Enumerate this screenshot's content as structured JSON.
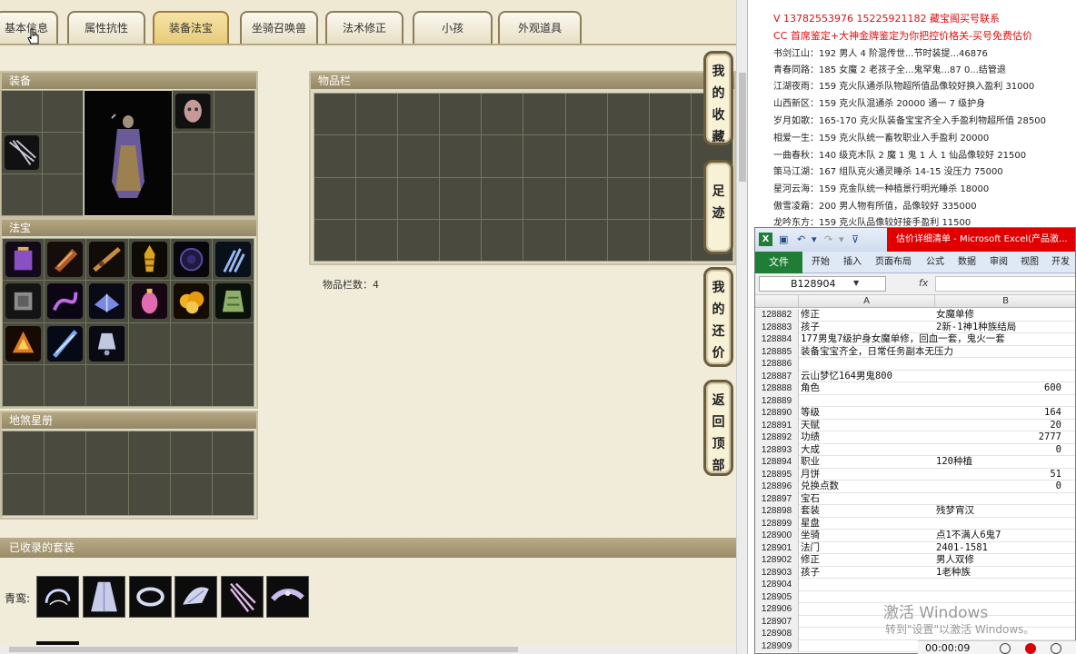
{
  "tabs": [
    {
      "label": "基本信息",
      "active": false
    },
    {
      "label": "属性抗性",
      "active": false
    },
    {
      "label": "装备法宝",
      "active": true
    },
    {
      "label": "坐骑召唤兽",
      "active": false
    },
    {
      "label": "法术修正",
      "active": false
    },
    {
      "label": "小孩",
      "active": false
    },
    {
      "label": "外观道具",
      "active": false
    }
  ],
  "panels": {
    "equip_title": "装备",
    "fabao_title": "法宝",
    "disha_title": "地煞星册",
    "items_title": "物品栏",
    "items_count": "物品栏数：4",
    "sets_title": "已收录的套装",
    "set_label": "青鸾:"
  },
  "side_buttons": [
    {
      "label": "我的收藏"
    },
    {
      "label": "足迹"
    },
    {
      "label": "我的还价"
    },
    {
      "label": "返回顶部"
    }
  ],
  "doc": {
    "header_lines": [
      "V 13782553976    15225921182    藏宝阁买号联系",
      "CC 首席鉴定+大神金牌鉴定为你把控价格关-买号免费估价"
    ],
    "listings": [
      {
        "name": "书剑江山：",
        "text": "192 男人 4 阶混传世...节时装提...46876"
      },
      {
        "name": "青春同路：",
        "text": "185 女魔 2 老孩子全...鬼罕鬼...87 0...结管退"
      },
      {
        "name": "江湖夜雨：",
        "text": "159 克火队通杀队物超所值品像较好换入盈利 31000"
      },
      {
        "name": "山西新区：",
        "text": "159 克火队混通杀 20000 通一 7 级护身"
      },
      {
        "name": "岁月如歌：",
        "text": "165-170 克火队装备宝宝齐全入手盈利物超所值 28500"
      },
      {
        "name": "相爱一生：",
        "text": "159 克火队统一畜牧职业入手盈利 20000"
      },
      {
        "name": "一曲春秋：",
        "text": "140 级克木队 2 魔 1 鬼 1 人 1 仙品像较好 21500"
      },
      {
        "name": "策马江湖：",
        "text": "167 组队克火通灵睡杀 14-15 没压力 75000"
      },
      {
        "name": "星河云海：",
        "text": "159 克金队统一种植景行明光睡杀 18000"
      },
      {
        "name": "傲雪凌霜：",
        "text": "200 男人物有所值，品像较好 335000"
      },
      {
        "name": "龙吟东方：",
        "text": "159 克火队品像较好接手盈利 11500"
      }
    ]
  },
  "excel": {
    "title": "估价详细清单 - Microsoft Excel(产品激...",
    "file_tab": "文件",
    "menu": [
      "开始",
      "插入",
      "页面布局",
      "公式",
      "数据",
      "审阅",
      "视图",
      "开发工"
    ],
    "name_box": "B128904",
    "fx": "fx",
    "col_headers": [
      "A",
      "B"
    ],
    "rows": [
      {
        "n": "128882",
        "a": "修正",
        "b": "女魔单修",
        "num": false
      },
      {
        "n": "128883",
        "a": "孩子",
        "b": "2新-1神1种族结局",
        "num": false
      },
      {
        "n": "128884",
        "a": "177男鬼7级护身女魔单修，回血一套，鬼火一套",
        "b": "",
        "num": false
      },
      {
        "n": "128885",
        "a": "装备宝宝齐全，日常任务副本无压力",
        "b": "",
        "num": false
      },
      {
        "n": "128886",
        "a": "",
        "b": "",
        "num": false
      },
      {
        "n": "128887",
        "a": "云山梦忆164男鬼800",
        "b": "",
        "num": false
      },
      {
        "n": "128888",
        "a": "角色",
        "b": "600",
        "num": true
      },
      {
        "n": "128889",
        "a": "",
        "b": "",
        "num": false
      },
      {
        "n": "128890",
        "a": "等级",
        "b": "164",
        "num": true
      },
      {
        "n": "128891",
        "a": "天赋",
        "b": "20",
        "num": true
      },
      {
        "n": "128892",
        "a": "功绩",
        "b": "2777",
        "num": true
      },
      {
        "n": "128893",
        "a": "大成",
        "b": "0",
        "num": true
      },
      {
        "n": "128894",
        "a": "职业",
        "b": "120种植",
        "num": false
      },
      {
        "n": "128895",
        "a": "月饼",
        "b": "51",
        "num": true
      },
      {
        "n": "128896",
        "a": "兑换点数",
        "b": "0",
        "num": true
      },
      {
        "n": "128897",
        "a": "宝石",
        "b": "",
        "num": false
      },
      {
        "n": "128898",
        "a": "套装",
        "b": "残梦宵汉",
        "num": false
      },
      {
        "n": "128899",
        "a": "星盘",
        "b": "",
        "num": false
      },
      {
        "n": "128900",
        "a": "坐骑",
        "b": "点1不满人6鬼7",
        "num": false
      },
      {
        "n": "128901",
        "a": "法门",
        "b": "2401-1581",
        "num": false
      },
      {
        "n": "128902",
        "a": "修正",
        "b": "男人双修",
        "num": false
      },
      {
        "n": "128903",
        "a": "孩子",
        "b": "1老种族",
        "num": false
      },
      {
        "n": "128904",
        "a": "",
        "b": "",
        "num": false
      },
      {
        "n": "128905",
        "a": "",
        "b": "",
        "num": false
      },
      {
        "n": "128906",
        "a": "",
        "b": "",
        "num": false
      },
      {
        "n": "128907",
        "a": "",
        "b": "",
        "num": false
      },
      {
        "n": "128908",
        "a": "",
        "b": "",
        "num": false
      },
      {
        "n": "128909",
        "a": "",
        "b": "",
        "num": false
      }
    ]
  },
  "watermark": {
    "line1": "激活 Windows",
    "line2": "转到\"设置\"以激活 Windows。"
  },
  "recorder": {
    "time": "00:00:09"
  },
  "colors": {
    "accent_red": "#e00000",
    "excel_green": "#1f7d35",
    "tab_active": "#e6cb7a"
  }
}
